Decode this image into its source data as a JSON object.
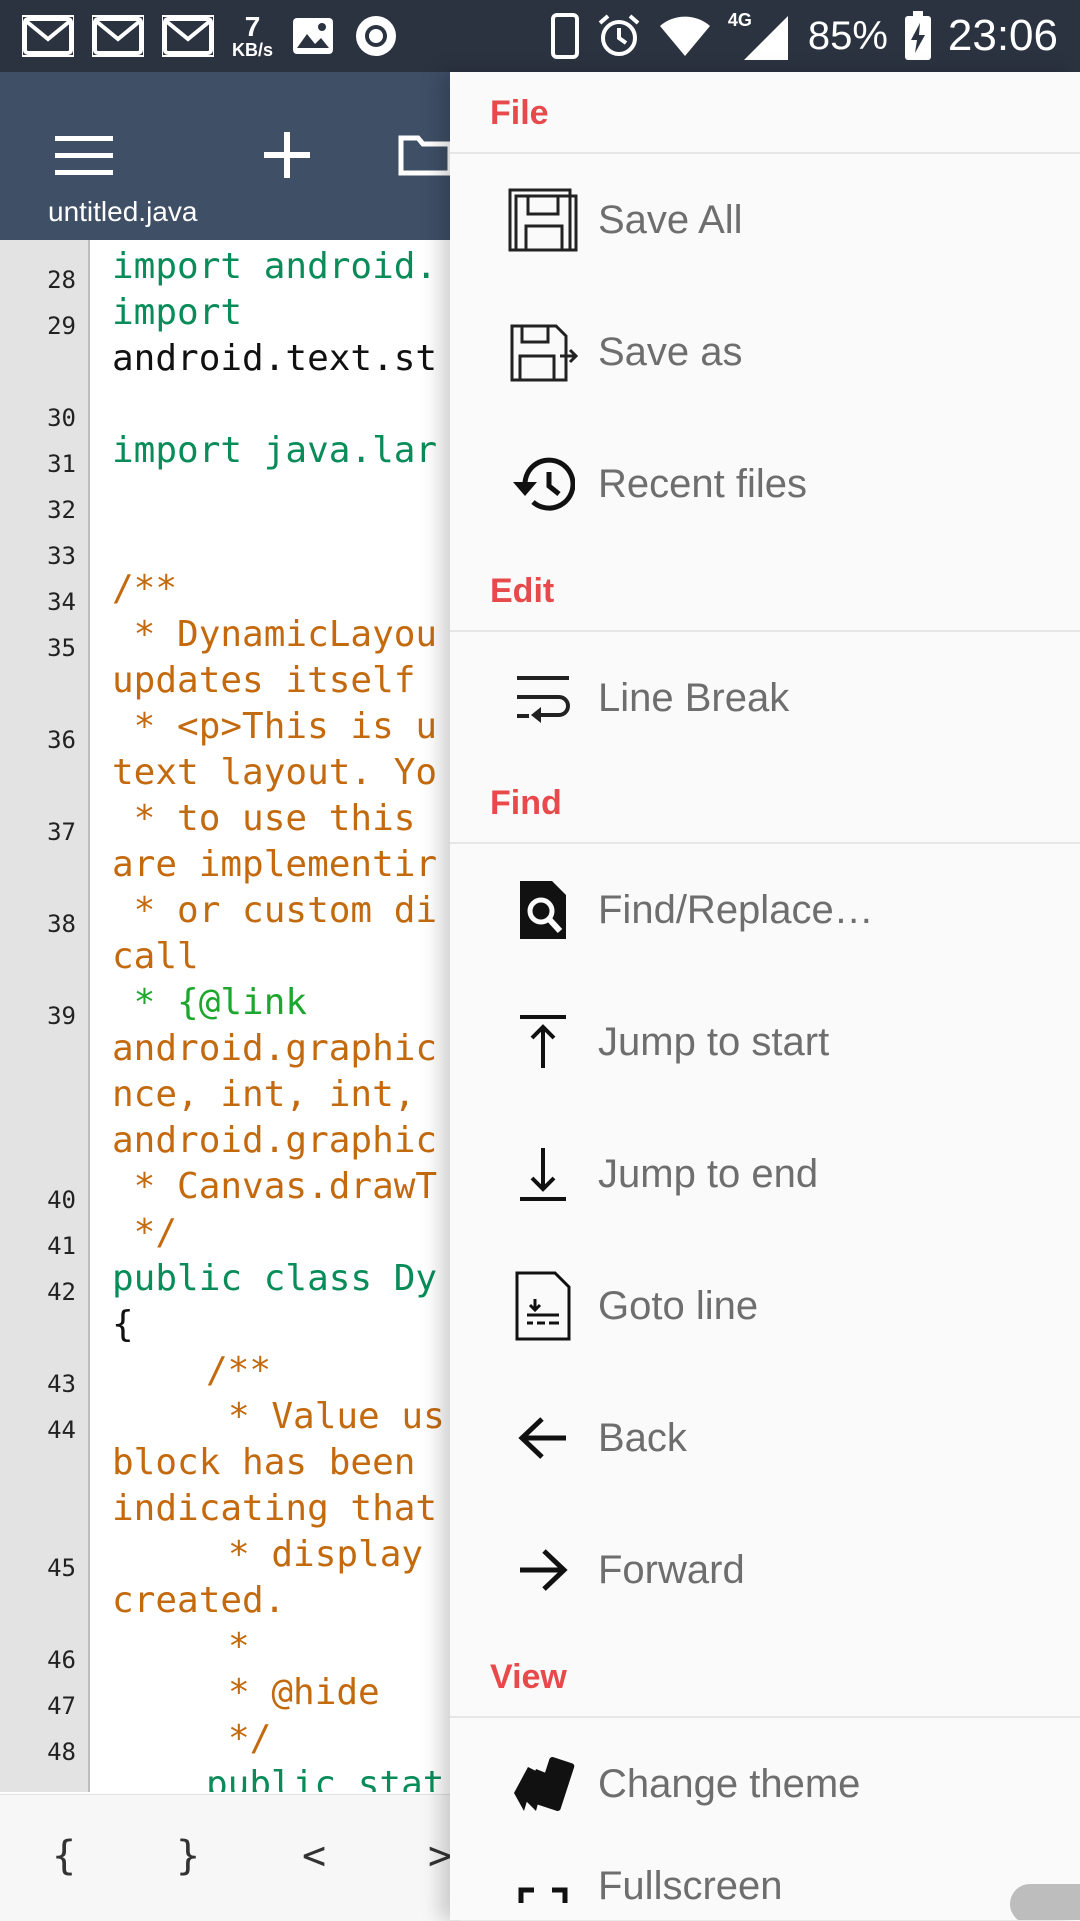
{
  "status_bar": {
    "net_speed_value": "7",
    "net_speed_unit": "KB/s",
    "network_type": "4G",
    "battery": "85%",
    "time": "23:06"
  },
  "app_bar": {
    "file_name": "untitled.java"
  },
  "editor": {
    "line_numbers": [
      "28",
      "29",
      "30",
      "31",
      "32",
      "33",
      "34",
      "35",
      "36",
      "37",
      "38",
      "39",
      "40",
      "41",
      "42",
      "43",
      "44",
      "45",
      "46",
      "47",
      "48"
    ],
    "code_lines": [
      "import android.",
      "import",
      "android.text.st",
      "import java.lar",
      "/**",
      " * DynamicLayou",
      "updates itself",
      " * <p>This is u",
      "text layout. Yo",
      " * to use this",
      "are implementir",
      " * or custom di",
      "call",
      " * {@link",
      "android.graphic",
      "nce, int, int,",
      "android.graphic",
      " * Canvas.drawT",
      " */",
      "public class Dy",
      "{",
      "/**",
      "* Value us",
      "block has been",
      "indicating that",
      "* display",
      "created.",
      "*",
      "* @hide",
      "*/",
      "public stat"
    ]
  },
  "symbols": [
    "{",
    "}",
    "<",
    ">"
  ],
  "drawer": {
    "sections": {
      "file": "File",
      "edit": "Edit",
      "find": "Find",
      "view": "View"
    },
    "items": {
      "save_all": "Save All",
      "save_as": "Save as",
      "recent_files": "Recent files",
      "line_break": "Line Break",
      "find_replace": "Find/Replace…",
      "jump_to_start": "Jump to start",
      "jump_to_end": "Jump to end",
      "goto_line": "Goto line",
      "back": "Back",
      "forward": "Forward",
      "change_theme": "Change theme",
      "fullscreen": "Fullscreen"
    }
  },
  "colors": {
    "status_bar": "#2b3340",
    "app_bar": "#3f4f66",
    "section_header": "#e8494b",
    "keyword": "#0a8c5a",
    "comment": "#c46a0e"
  }
}
